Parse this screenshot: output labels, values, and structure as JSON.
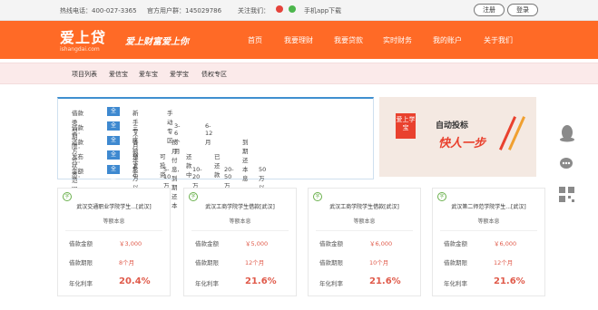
{
  "topbar": {
    "phone": "热线电话：400-027-3365",
    "qq": "官方用户群：145029786",
    "follow": "关注我们：",
    "app": "手机app下载",
    "register": "注册",
    "login": "登录"
  },
  "header": {
    "logo_cn": "爱上贷",
    "logo_en": "ishangdai.com",
    "slogan": "爱上财富爱上你",
    "nav": [
      "首页",
      "我要理财",
      "我要贷款",
      "实时财务",
      "我的账户",
      "关于我们"
    ]
  },
  "subnav": [
    "项目列表",
    "爱信宝",
    "爱车宝",
    "爱学宝",
    "债权专区"
  ],
  "filters": [
    {
      "label": "借款类型：",
      "all": "全部",
      "options": [
        "新手专区",
        "手动专区"
      ]
    },
    {
      "label": "借款期限：",
      "all": "全部",
      "options": [
        "三个月以下",
        "3-6个月",
        "6-12月"
      ]
    },
    {
      "label": "还款方式：",
      "all": "全部",
      "options": [
        "等额本息",
        "按月付息,到期还本",
        "到期还本息"
      ]
    },
    {
      "label": "发布状态：",
      "all": "全部",
      "options": [
        "预发布",
        "可投资",
        "还款中",
        "已还款"
      ]
    },
    {
      "label": "金额范围：",
      "all": "全部",
      "options": [
        "5万以下",
        "5-10万",
        "10-20万",
        "20-50万",
        "50万以上"
      ]
    }
  ],
  "banner": {
    "tag": "爱上学宝",
    "line1": "自动投标",
    "line2": "快人一步"
  },
  "cards": [
    {
      "badge": "字",
      "title": "武汉交通职业学院学生...[武汉]",
      "type": "等额本息",
      "amount_label": "借款金额",
      "amount": "￥3,000",
      "term_label": "借款期限",
      "term": "8个月",
      "rate_label": "年化利率",
      "rate": "20.4%"
    },
    {
      "badge": "字",
      "title": "武汉工商学院学生借款[武汉]",
      "type": "等额本息",
      "amount_label": "借款金额",
      "amount": "￥5,000",
      "term_label": "借款期限",
      "term": "12个月",
      "rate_label": "年化利率",
      "rate": "21.6%"
    },
    {
      "badge": "字",
      "title": "武汉工商学院学生借款[武汉]",
      "type": "等额本息",
      "amount_label": "借款金额",
      "amount": "￥6,000",
      "term_label": "借款期限",
      "term": "10个月",
      "rate_label": "年化利率",
      "rate": "21.6%"
    },
    {
      "badge": "字",
      "title": "武汉第二师范学院学生...[武汉]",
      "type": "等额本息",
      "amount_label": "借款金额",
      "amount": "￥6,000",
      "term_label": "借款期限",
      "term": "12个月",
      "rate_label": "年化利率",
      "rate": "21.6%"
    }
  ],
  "colors": {
    "brand": "#ff6a26",
    "filter_active": "#3e89d0",
    "accent_red": "#e05a4a"
  },
  "icons": [
    "weibo-icon",
    "wechat-icon",
    "qq-penguin-icon",
    "chat-bubble-icon",
    "qr-code-icon"
  ]
}
